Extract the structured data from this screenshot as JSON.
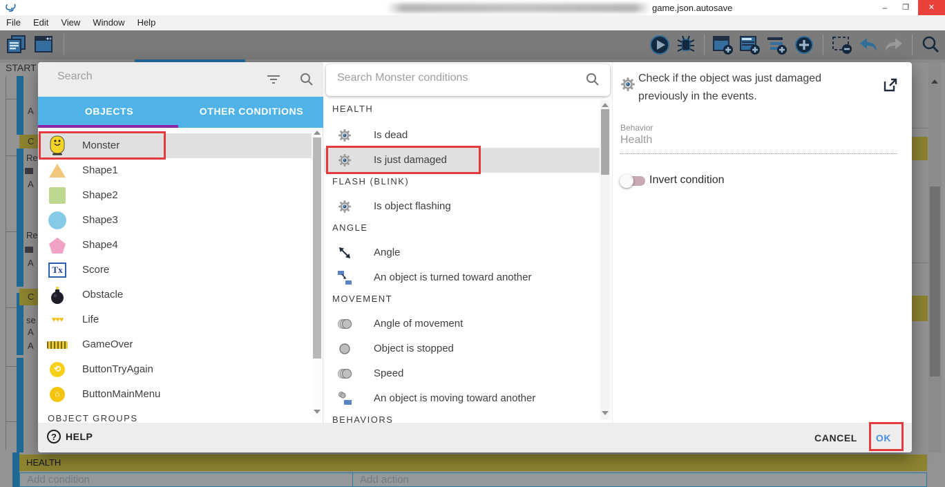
{
  "window": {
    "title_suffix": "game.json.autosave",
    "minimize": "–",
    "maximize": "❐",
    "close": "✕"
  },
  "menu": {
    "items": [
      "File",
      "Edit",
      "View",
      "Window",
      "Help"
    ]
  },
  "background": {
    "scene_tab": "START",
    "health_section": "HEALTH",
    "add_condition": "Add condition",
    "add_action": "Add action",
    "left_fragments": [
      {
        "t": "A"
      },
      {
        "t": "C"
      },
      {
        "t": "Re"
      },
      {
        "t": "A"
      },
      {
        "t": "Re"
      },
      {
        "t": "A"
      },
      {
        "t": "C"
      },
      {
        "t": "se"
      },
      {
        "t": "A"
      },
      {
        "t": "A"
      }
    ]
  },
  "dialog": {
    "left": {
      "search_placeholder": "Search",
      "tabs": [
        {
          "label": "OBJECTS"
        },
        {
          "label": "OTHER CONDITIONS"
        }
      ],
      "objects": [
        {
          "label": "Monster"
        },
        {
          "label": "Shape1"
        },
        {
          "label": "Shape2"
        },
        {
          "label": "Shape3"
        },
        {
          "label": "Shape4"
        },
        {
          "label": "Score"
        },
        {
          "label": "Obstacle"
        },
        {
          "label": "Life"
        },
        {
          "label": "GameOver"
        },
        {
          "label": "ButtonTryAgain"
        },
        {
          "label": "ButtonMainMenu"
        }
      ],
      "groups_header": "OBJECT GROUPS"
    },
    "middle": {
      "search_placeholder": "Search Monster conditions",
      "sections": [
        {
          "header": "HEALTH",
          "items": [
            {
              "label": "Is dead"
            },
            {
              "label": "Is just damaged"
            }
          ]
        },
        {
          "header": "FLASH (BLINK)",
          "items": [
            {
              "label": "Is object flashing"
            }
          ]
        },
        {
          "header": "ANGLE",
          "items": [
            {
              "label": "Angle"
            },
            {
              "label": "An object is turned toward another"
            }
          ]
        },
        {
          "header": "MOVEMENT",
          "items": [
            {
              "label": "Angle of movement"
            },
            {
              "label": "Object is stopped"
            },
            {
              "label": "Speed"
            },
            {
              "label": "An object is moving toward another"
            }
          ]
        },
        {
          "header": "BEHAVIORS",
          "items": []
        }
      ]
    },
    "right": {
      "description": "Check if the object was just damaged previously in the events.",
      "behavior_label": "Behavior",
      "behavior_value": "Health",
      "invert_label": "Invert condition"
    },
    "footer": {
      "help": "HELP",
      "cancel": "CANCEL",
      "ok": "OK"
    }
  },
  "colors": {
    "tab_bar_blue": "#4fb3e8",
    "tab_indicator_purple": "#8e24aa",
    "annotation_red": "#e13b3f",
    "ok_blue": "#4a90e2",
    "selected_row_gray": "#e0e0e0",
    "comment_olive": "#8d8430",
    "close_button_red": "#e8413c"
  }
}
